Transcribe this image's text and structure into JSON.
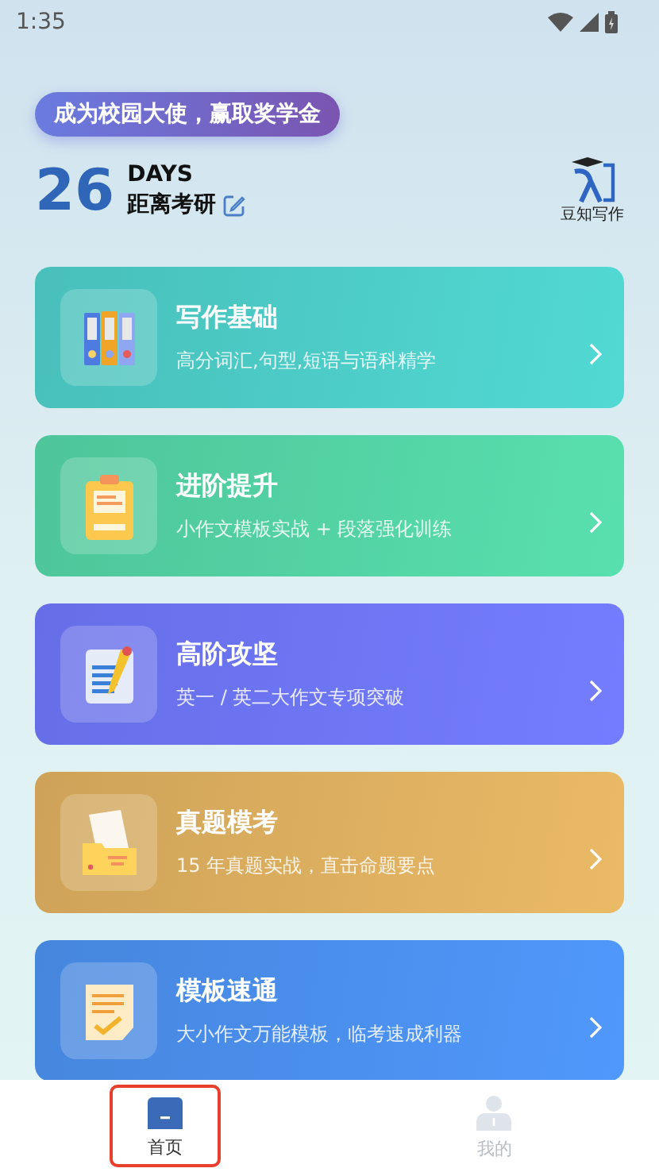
{
  "status_bar": {
    "time": "1:35"
  },
  "promo_badge": "成为校园大使，赢取奖学金",
  "countdown": {
    "days": "26",
    "unit": "DAYS",
    "label": "距离考研"
  },
  "logo": {
    "caption": "豆知写作"
  },
  "cards": [
    {
      "kind": "binders",
      "title": "写作基础",
      "subtitle": "高分词汇,句型,短语与语科精学",
      "color": "#4cc9c4"
    },
    {
      "kind": "clipboard",
      "title": "进阶提升",
      "subtitle": "小作文模板实战 + 段落强化训练",
      "color": "#52cfa2"
    },
    {
      "kind": "pencil",
      "title": "高阶攻坚",
      "subtitle": "英一 / 英二大作文专项突破",
      "color": "#6b74f3"
    },
    {
      "kind": "folder",
      "title": "真题模考",
      "subtitle": "15 年真题实战，直击命题要点",
      "color": "#d9ac5e"
    },
    {
      "kind": "note",
      "title": "模板速通",
      "subtitle": "大小作文万能模板，临考速成利器",
      "color": "#4a8de9"
    }
  ],
  "tabs": [
    {
      "kind": "home",
      "label": "首页",
      "selected": true,
      "highlighted": true
    },
    {
      "kind": "profile",
      "label": "我的",
      "selected": false,
      "highlighted": false
    }
  ]
}
